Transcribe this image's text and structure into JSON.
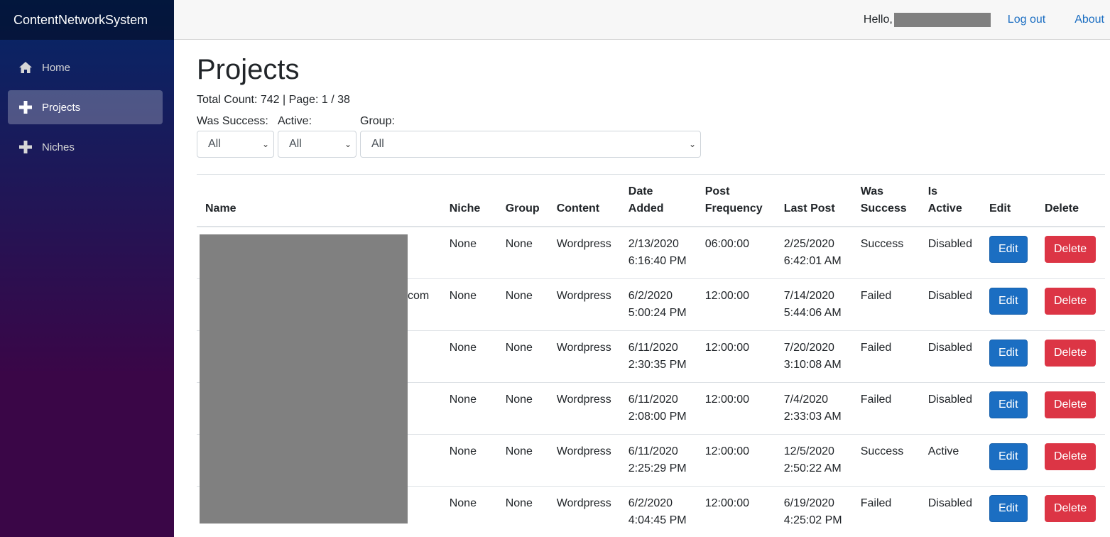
{
  "brand": "ContentNetworkSystem",
  "nav": [
    {
      "label": "Home",
      "icon": "home-icon"
    },
    {
      "label": "Projects",
      "icon": "plus-icon",
      "active": true
    },
    {
      "label": "Niches",
      "icon": "plus-icon"
    }
  ],
  "topbar": {
    "hello": "Hello,",
    "logout": "Log out",
    "about": "About"
  },
  "page": {
    "title": "Projects",
    "count_prefix": "Total Count: ",
    "total_count": "742",
    "page_sep": " | Page: ",
    "page_current": "1",
    "page_slash": " / ",
    "page_total": "38"
  },
  "filters": {
    "was_success": {
      "label": "Was Success:",
      "value": "All"
    },
    "active": {
      "label": "Active:",
      "value": "All"
    },
    "group": {
      "label": "Group:",
      "value": "All"
    }
  },
  "table": {
    "headers": {
      "name": "Name",
      "niche": "Niche",
      "group": "Group",
      "content": "Content",
      "date_added_1": "Date",
      "date_added_2": "Added",
      "post_freq_1": "Post",
      "post_freq_2": "Frequency",
      "last_post": "Last Post",
      "was_success_1": "Was",
      "was_success_2": "Success",
      "is_active_1": "Is",
      "is_active_2": "Active",
      "edit": "Edit",
      "delete": "Delete"
    },
    "rows": [
      {
        "name_suffix": "",
        "niche": "None",
        "group": "None",
        "content": "Wordpress",
        "date1": "2/13/2020",
        "date2": "6:16:40 PM",
        "freq": "06:00:00",
        "last1": "2/25/2020",
        "last2": "6:42:01 AM",
        "success": "Success",
        "active": "Disabled",
        "edit": "Edit",
        "delete": "Delete"
      },
      {
        "name_suffix": "com",
        "niche": "None",
        "group": "None",
        "content": "Wordpress",
        "date1": "6/2/2020",
        "date2": "5:00:24 PM",
        "freq": "12:00:00",
        "last1": "7/14/2020",
        "last2": "5:44:06 AM",
        "success": "Failed",
        "active": "Disabled",
        "edit": "Edit",
        "delete": "Delete"
      },
      {
        "name_suffix": "",
        "niche": "None",
        "group": "None",
        "content": "Wordpress",
        "date1": "6/11/2020",
        "date2": "2:30:35 PM",
        "freq": "12:00:00",
        "last1": "7/20/2020",
        "last2": "3:10:08 AM",
        "success": "Failed",
        "active": "Disabled",
        "edit": "Edit",
        "delete": "Delete"
      },
      {
        "name_suffix": "",
        "niche": "None",
        "group": "None",
        "content": "Wordpress",
        "date1": "6/11/2020",
        "date2": "2:08:00 PM",
        "freq": "12:00:00",
        "last1": "7/4/2020",
        "last2": "2:33:03 AM",
        "success": "Failed",
        "active": "Disabled",
        "edit": "Edit",
        "delete": "Delete"
      },
      {
        "name_suffix": "",
        "niche": "None",
        "group": "None",
        "content": "Wordpress",
        "date1": "6/11/2020",
        "date2": "2:25:29 PM",
        "freq": "12:00:00",
        "last1": "12/5/2020",
        "last2": "2:50:22 AM",
        "success": "Success",
        "active": "Active",
        "edit": "Edit",
        "delete": "Delete"
      },
      {
        "name_suffix": "",
        "niche": "None",
        "group": "None",
        "content": "Wordpress",
        "date1": "6/2/2020",
        "date2": "4:04:45 PM",
        "freq": "12:00:00",
        "last1": "6/19/2020",
        "last2": "4:25:02 PM",
        "success": "Failed",
        "active": "Disabled",
        "edit": "Edit",
        "delete": "Delete"
      }
    ]
  }
}
